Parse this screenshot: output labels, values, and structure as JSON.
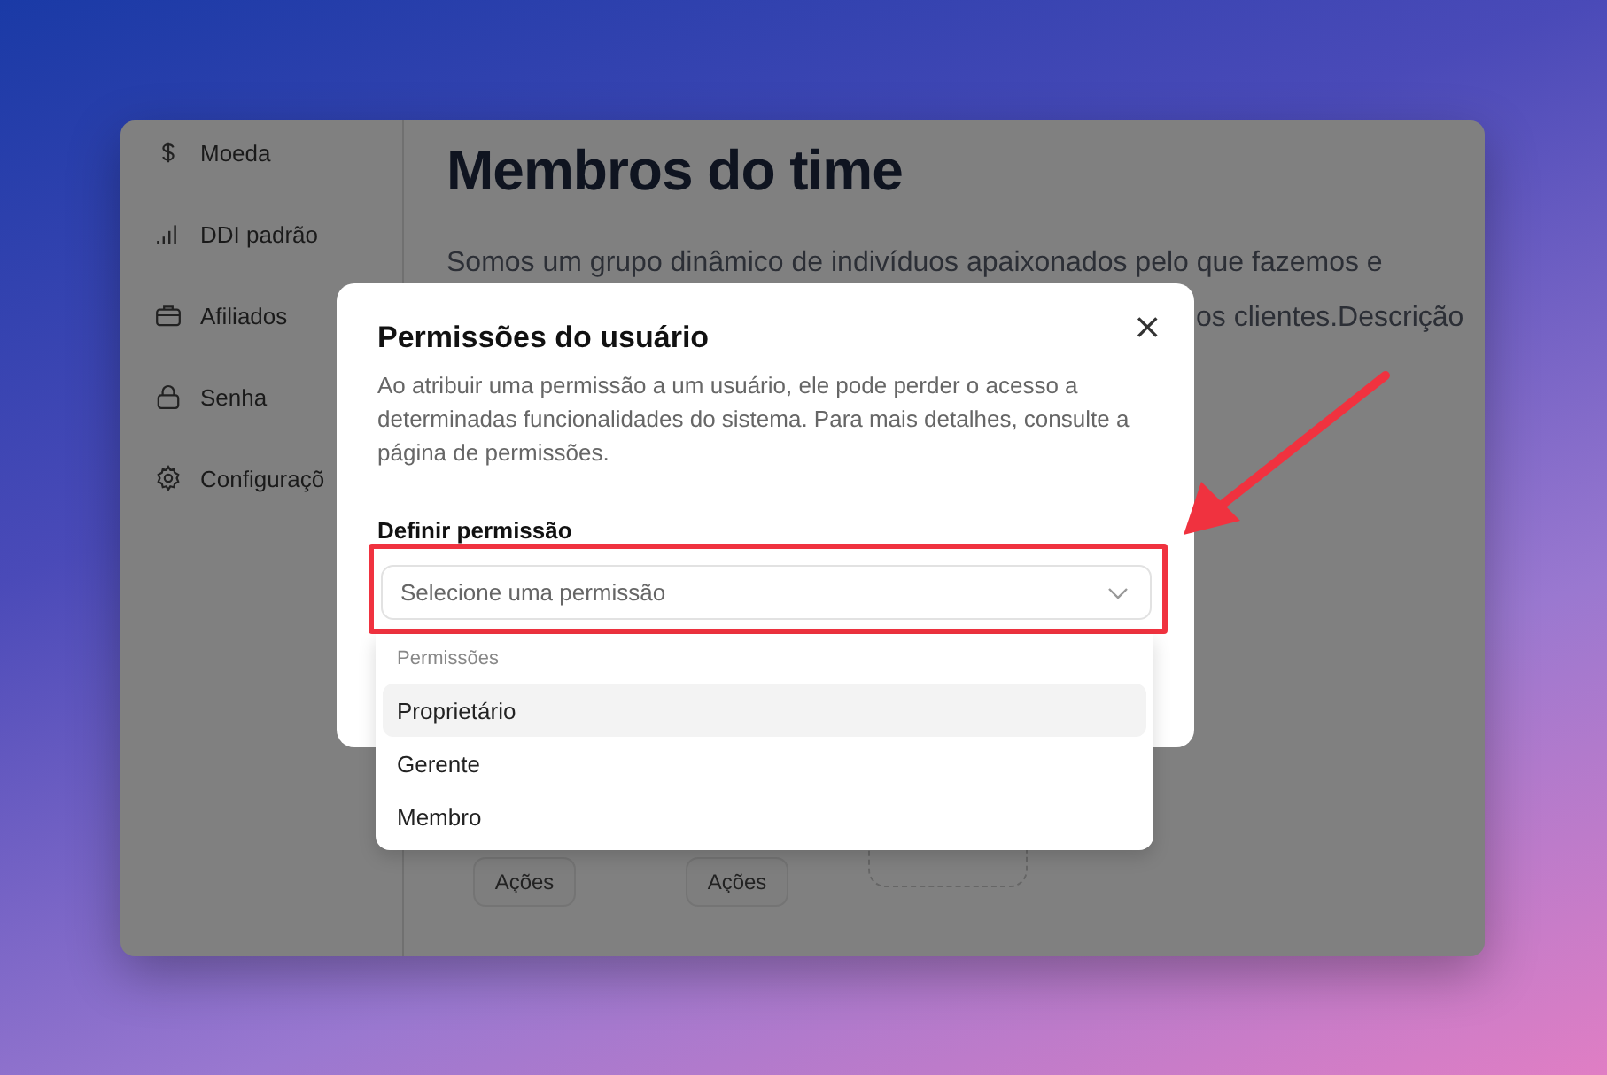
{
  "sidebar": {
    "items": [
      {
        "label": "Moeda"
      },
      {
        "label": "DDI padrão"
      },
      {
        "label": "Afiliados"
      },
      {
        "label": "Senha"
      },
      {
        "label": "Configuraçõ"
      }
    ]
  },
  "page": {
    "title": "Membros do time",
    "description_line_1": "Somos um grupo dinâmico de indivíduos apaixonados pelo que fazemos e",
    "description_line_2": "os clientes.Descrição",
    "buttons": [
      "Ações",
      "Ações"
    ]
  },
  "dialog": {
    "title": "Permissões do usuário",
    "description": "Ao atribuir uma permissão a um usuário, ele pode perder o acesso a determinadas funcionalidades do sistema. Para mais detalhes, consulte a página de permissões.",
    "close": "×",
    "field_label": "Definir permissão",
    "select": {
      "placeholder": "Selecione uma permissão"
    }
  },
  "dropdown": {
    "group_label": "Permissões",
    "options": [
      {
        "label": "Proprietário",
        "selected": true
      },
      {
        "label": "Gerente",
        "selected": false
      },
      {
        "label": "Membro",
        "selected": false
      }
    ]
  }
}
